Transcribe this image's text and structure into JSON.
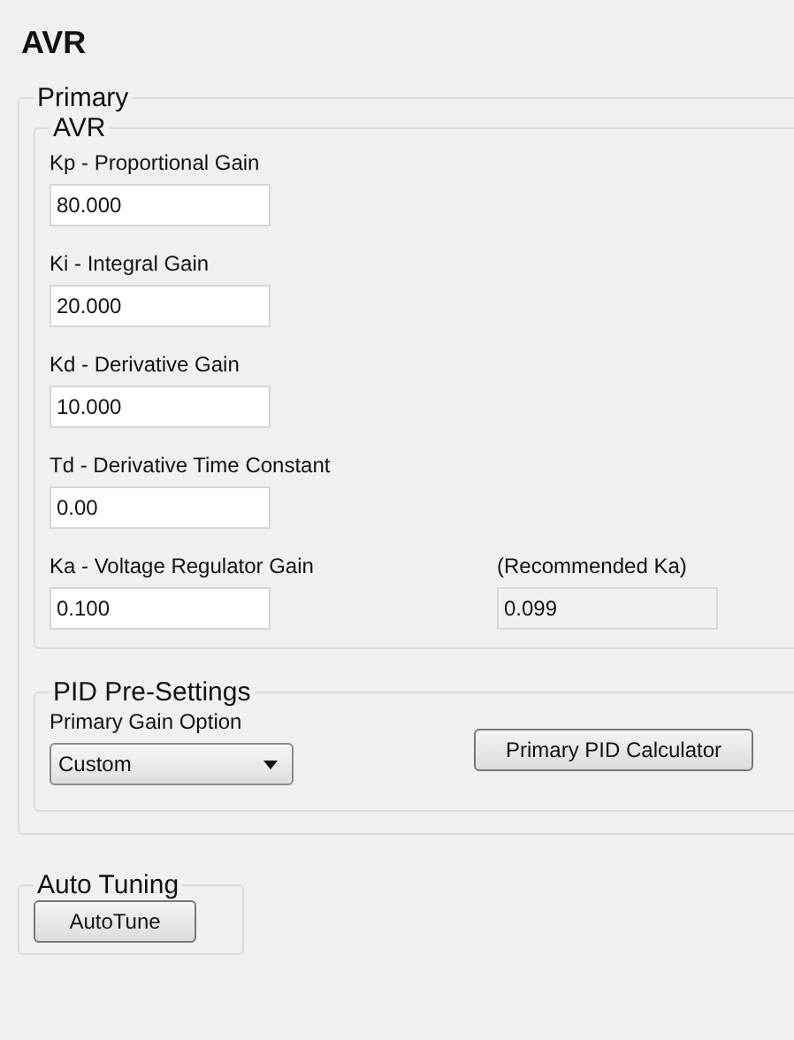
{
  "title": "AVR",
  "primary": {
    "legend": "Primary",
    "avr": {
      "legend": "AVR",
      "rows": [
        [
          {
            "label": "Kp - Proportional Gain",
            "value": "80.000",
            "disabled": false
          }
        ],
        [
          {
            "label": "Ki - Integral Gain",
            "value": "20.000",
            "disabled": false
          }
        ],
        [
          {
            "label": "Kd - Derivative Gain",
            "value": "10.000",
            "disabled": false
          }
        ],
        [
          {
            "label": "Td - Derivative Time Constant",
            "value": "0.00",
            "disabled": false
          }
        ],
        [
          {
            "label": "Ka - Voltage Regulator Gain",
            "value": "0.100",
            "disabled": false
          },
          {
            "label": "(Recommended Ka)",
            "value": "0.099",
            "disabled": true
          }
        ]
      ]
    },
    "pid": {
      "legend": "PID Pre-Settings",
      "dropdown_label": "Primary Gain Option",
      "dropdown_value": "Custom",
      "button": "Primary PID Calculator"
    }
  },
  "auto_tuning": {
    "legend": "Auto Tuning",
    "button": "AutoTune"
  }
}
